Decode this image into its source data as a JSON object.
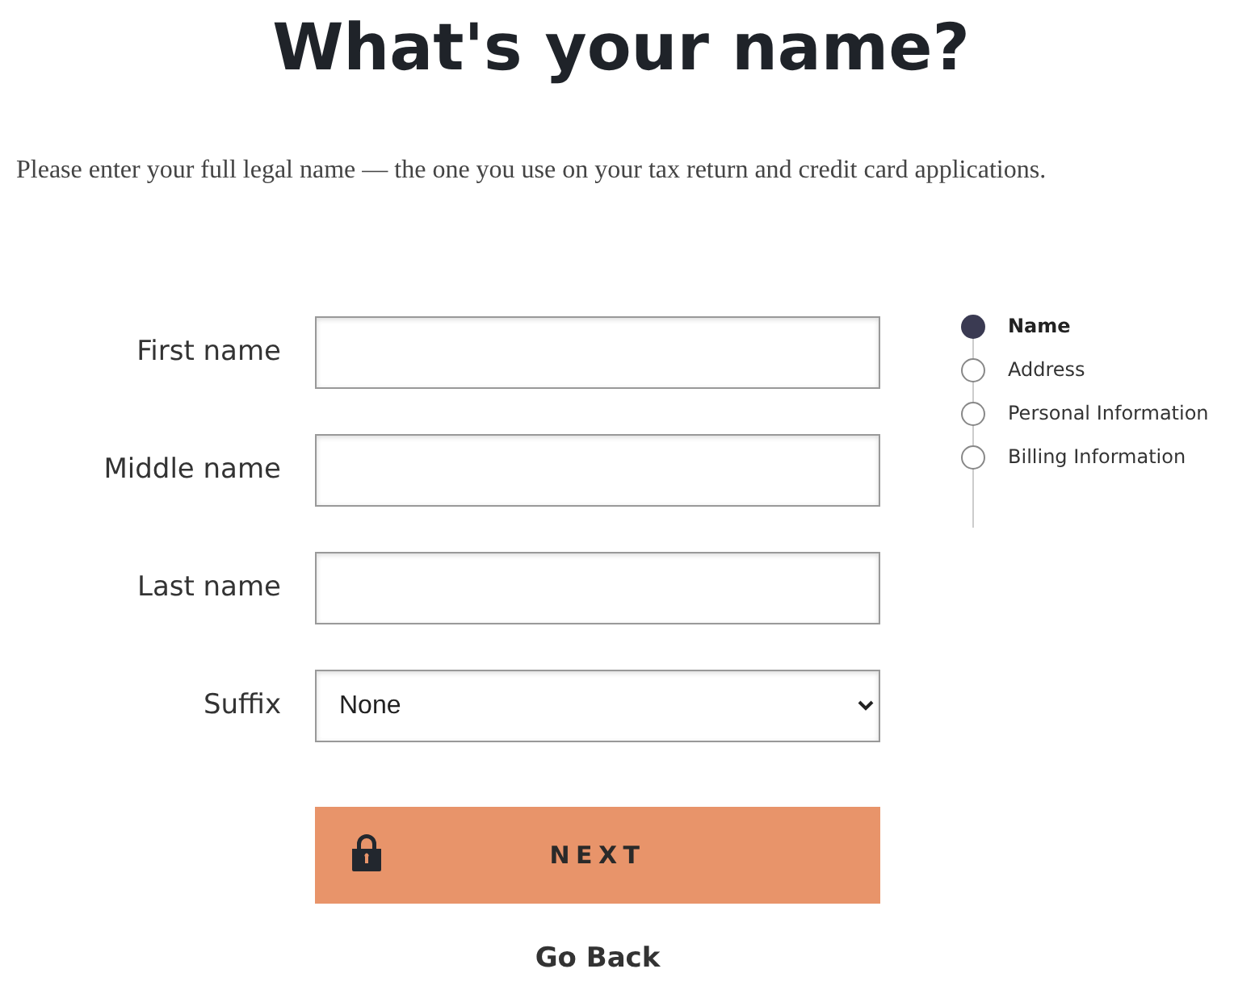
{
  "title": "What's your name?",
  "intro": "Please enter your full legal name — the one you use on your tax return and credit card applications.",
  "fields": [
    {
      "label": "First name",
      "kind": "text"
    },
    {
      "label": "Middle name",
      "kind": "text"
    },
    {
      "label": "Last name",
      "kind": "text"
    },
    {
      "label": "Suffix",
      "kind": "select",
      "value": "None"
    }
  ],
  "next_button": "NEXT",
  "back_link": "Go Back",
  "steps": [
    {
      "label": "Name",
      "selected": true
    },
    {
      "label": "Address",
      "selected": false
    },
    {
      "label": "Personal Information",
      "selected": false
    },
    {
      "label": "Billing Information",
      "selected": false
    }
  ]
}
